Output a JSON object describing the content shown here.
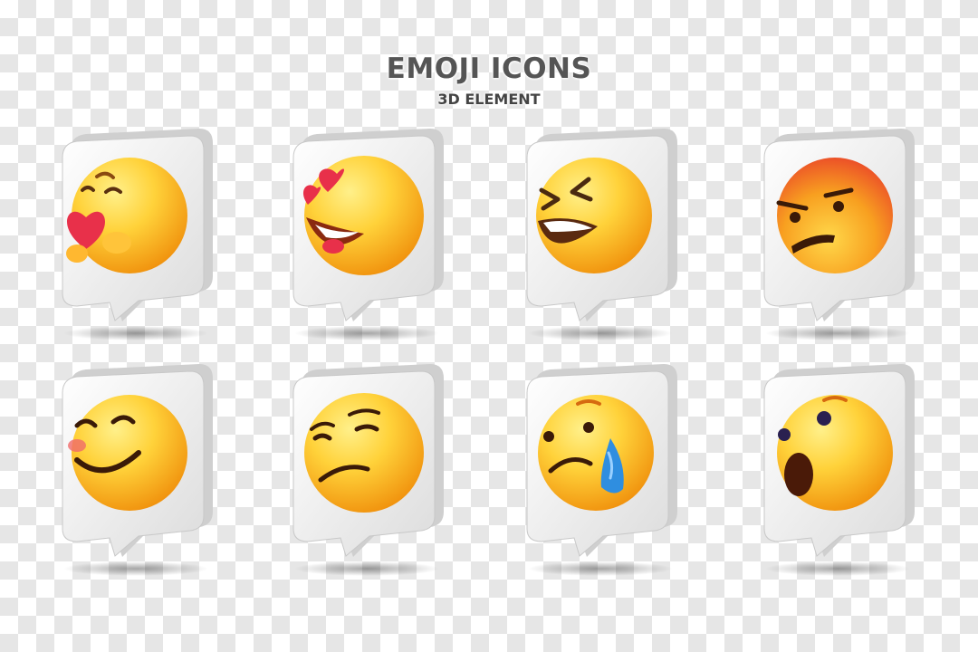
{
  "header": {
    "title": "EMOJI ICONS",
    "subtitle": "3D ELEMENT"
  },
  "emojis": [
    {
      "icon": "care-hug-icon"
    },
    {
      "icon": "heart-eyes-icon"
    },
    {
      "icon": "laughing-icon"
    },
    {
      "icon": "angry-icon"
    },
    {
      "icon": "blushing-smile-icon"
    },
    {
      "icon": "smirk-icon"
    },
    {
      "icon": "crying-icon"
    },
    {
      "icon": "surprised-icon"
    }
  ],
  "colors": {
    "face_light": "#ffe066",
    "face_dark": "#f29a12",
    "heart": "#e8304a",
    "tear": "#2f8ee0",
    "angry_red": "#e8382a",
    "bubble": "#f4f4f4"
  }
}
